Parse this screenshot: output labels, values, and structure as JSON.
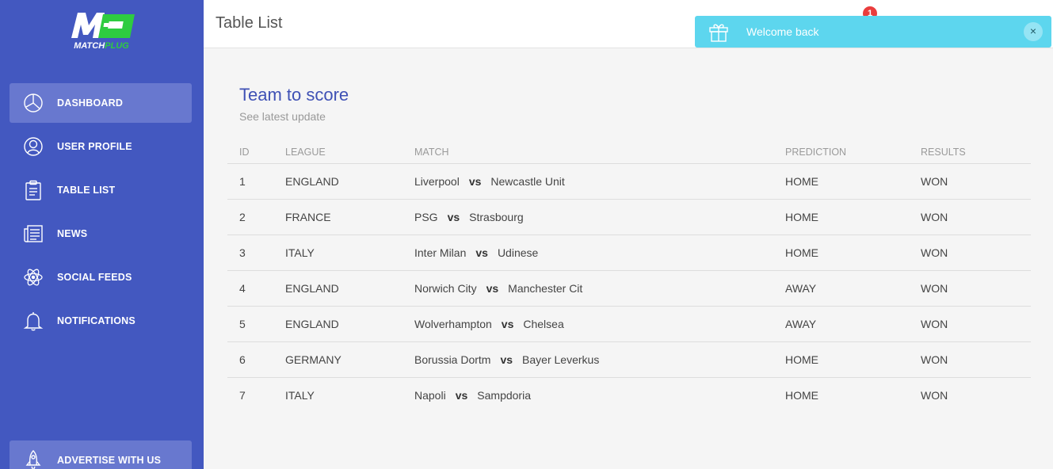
{
  "brand": {
    "logo_text_white": "MATCH",
    "logo_text_green": "PLUG",
    "colors": {
      "primary": "#4358c0",
      "accent": "#2ecc40"
    }
  },
  "sidebar": {
    "items": [
      {
        "label": "DASHBOARD",
        "icon": "pie-chart-icon",
        "active": true
      },
      {
        "label": "USER PROFILE",
        "icon": "user-icon",
        "active": false
      },
      {
        "label": "TABLE LIST",
        "icon": "clipboard-icon",
        "active": false
      },
      {
        "label": "NEWS",
        "icon": "newspaper-icon",
        "active": false
      },
      {
        "label": "SOCIAL FEEDS",
        "icon": "atom-icon",
        "active": false
      },
      {
        "label": "NOTIFICATIONS",
        "icon": "bell-icon",
        "active": false
      }
    ],
    "advertise": {
      "label": "ADVERTISE WITH US",
      "icon": "rocket-icon"
    }
  },
  "header": {
    "title": "Table List",
    "notification_count": "1"
  },
  "toast": {
    "message": "Welcome back",
    "icon": "gift-icon",
    "close": "×",
    "color": "#5dd6ee"
  },
  "card": {
    "title": "Team to score",
    "subtitle": "See latest update",
    "columns": [
      "ID",
      "LEAGUE",
      "MATCH",
      "PREDICTION",
      "RESULTS"
    ],
    "vs_label": "vs",
    "rows": [
      {
        "id": "1",
        "league": "ENGLAND",
        "home": "Liverpool",
        "away": "Newcastle Unit",
        "prediction": "HOME",
        "result": "WON"
      },
      {
        "id": "2",
        "league": "FRANCE",
        "home": "PSG",
        "away": "Strasbourg",
        "prediction": "HOME",
        "result": "WON"
      },
      {
        "id": "3",
        "league": "ITALY",
        "home": "Inter Milan",
        "away": "Udinese",
        "prediction": "HOME",
        "result": "WON"
      },
      {
        "id": "4",
        "league": "ENGLAND",
        "home": "Norwich City",
        "away": "Manchester Cit",
        "prediction": "AWAY",
        "result": "WON"
      },
      {
        "id": "5",
        "league": "ENGLAND",
        "home": "Wolverhampton",
        "away": "Chelsea",
        "prediction": "AWAY",
        "result": "WON"
      },
      {
        "id": "6",
        "league": "GERMANY",
        "home": "Borussia Dortm",
        "away": "Bayer Leverkus",
        "prediction": "HOME",
        "result": "WON"
      },
      {
        "id": "7",
        "league": "ITALY",
        "home": "Napoli",
        "away": "Sampdoria",
        "prediction": "HOME",
        "result": "WON"
      }
    ]
  }
}
